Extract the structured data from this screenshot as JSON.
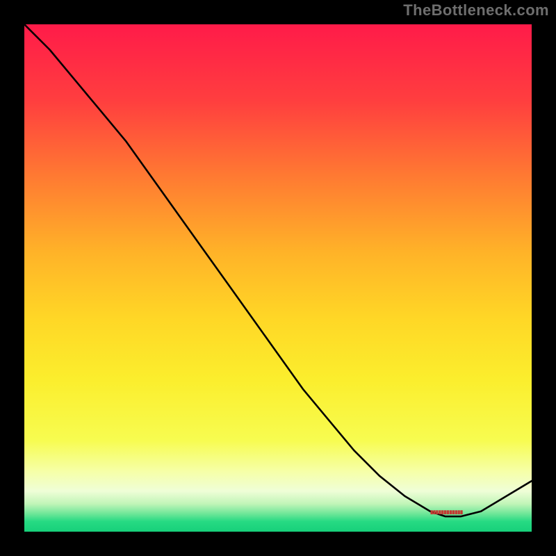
{
  "watermark": "TheBottleneck.com",
  "chart_data": {
    "type": "line",
    "title": "",
    "xlabel": "",
    "ylabel": "",
    "x": [
      0.0,
      0.05,
      0.1,
      0.15,
      0.2,
      0.25,
      0.3,
      0.35,
      0.4,
      0.45,
      0.5,
      0.55,
      0.6,
      0.65,
      0.7,
      0.75,
      0.8,
      0.83,
      0.86,
      0.9,
      0.95,
      1.0
    ],
    "values": [
      1.0,
      0.95,
      0.89,
      0.83,
      0.77,
      0.7,
      0.63,
      0.56,
      0.49,
      0.42,
      0.35,
      0.28,
      0.22,
      0.16,
      0.11,
      0.07,
      0.04,
      0.03,
      0.03,
      0.04,
      0.07,
      0.1
    ],
    "xlim": [
      0,
      1
    ],
    "ylim": [
      0,
      1
    ],
    "background_gradient": [
      {
        "y": 1.0,
        "color": "#ff1b49"
      },
      {
        "y": 0.85,
        "color": "#ff3e3f"
      },
      {
        "y": 0.7,
        "color": "#ff7a32"
      },
      {
        "y": 0.55,
        "color": "#ffb328"
      },
      {
        "y": 0.42,
        "color": "#ffd726"
      },
      {
        "y": 0.3,
        "color": "#fbee2d"
      },
      {
        "y": 0.18,
        "color": "#f7fc50"
      },
      {
        "y": 0.12,
        "color": "#f6ffa6"
      },
      {
        "y": 0.08,
        "color": "#effed7"
      },
      {
        "y": 0.055,
        "color": "#c1f5b8"
      },
      {
        "y": 0.035,
        "color": "#6de698"
      },
      {
        "y": 0.02,
        "color": "#26da83"
      },
      {
        "y": 0.0,
        "color": "#17d07a"
      }
    ],
    "marker_band": {
      "y": 0.035,
      "x_start": 0.8,
      "x_end": 0.9,
      "color": "#c33a32"
    }
  }
}
